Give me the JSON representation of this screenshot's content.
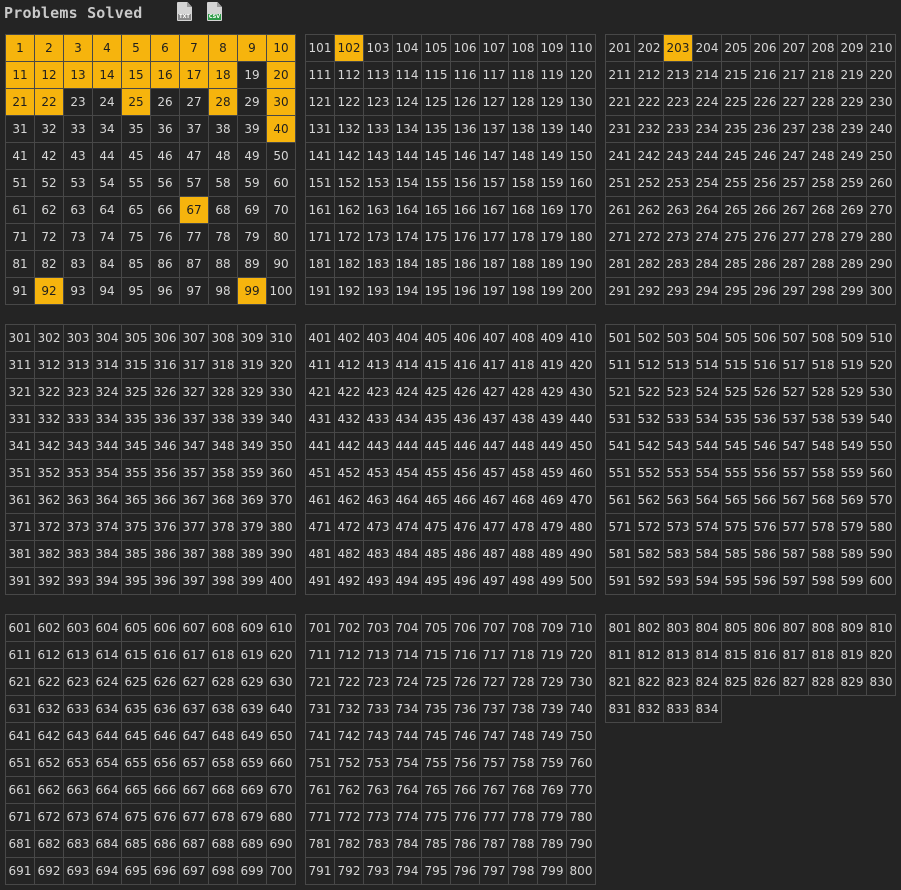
{
  "header": {
    "title": "Problems Solved",
    "txt_icon": "txt-file-download-icon",
    "txt_tag": "TXT",
    "csv_icon": "csv-file-download-icon",
    "csv_tag": "CSV"
  },
  "problems": {
    "total": 834,
    "per_block": 100,
    "solved": [
      1,
      2,
      3,
      4,
      5,
      6,
      7,
      8,
      9,
      10,
      11,
      12,
      13,
      14,
      15,
      16,
      17,
      18,
      20,
      21,
      22,
      25,
      28,
      30,
      40,
      67,
      92,
      99,
      102,
      203
    ]
  },
  "colors": {
    "background": "#242424",
    "cell_border": "#484848",
    "cell_text": "#d6d6d6",
    "solved": "#f6b40d",
    "solved_text": "#1f1f1f"
  }
}
